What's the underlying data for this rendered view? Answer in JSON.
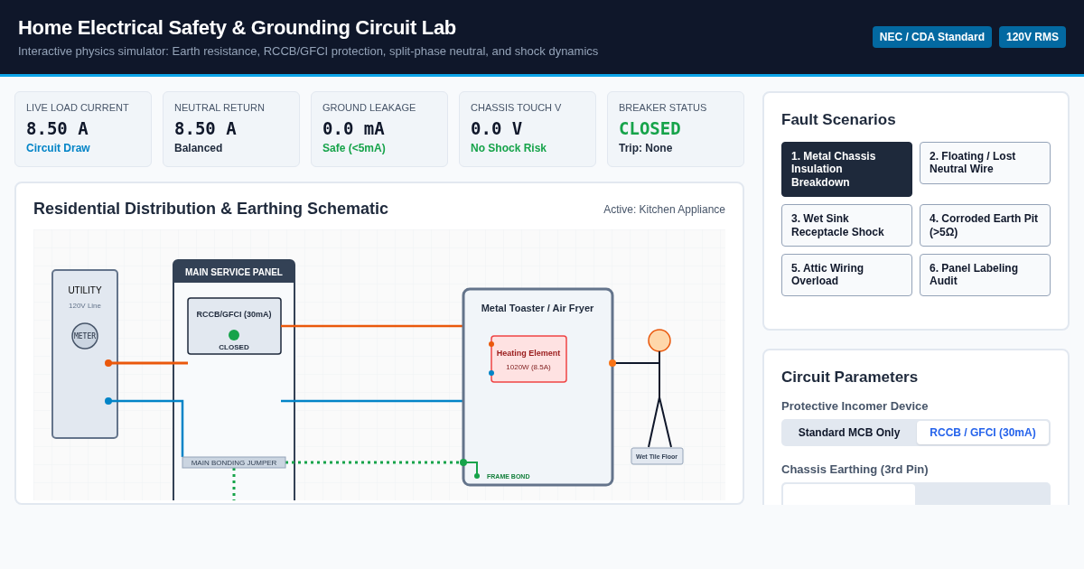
{
  "header": {
    "title": "Home Electrical Safety & Grounding Circuit Lab",
    "subtitle": "Interactive physics simulator: Earth resistance, RCCB/GFCI protection, split-phase neutral, and shock dynamics",
    "badges": [
      "NEC / CDA Standard",
      "120V RMS"
    ]
  },
  "stats": [
    {
      "label": "LIVE LOAD CURRENT",
      "kind": "reading",
      "value": "8.50 A",
      "note": "Circuit Draw",
      "color": "#0284c7"
    },
    {
      "label": "NEUTRAL RETURN",
      "kind": "reading",
      "value": "8.50 A",
      "note": "Balanced",
      "color": "#1e293b"
    },
    {
      "label": "GROUND LEAKAGE",
      "kind": "reading",
      "value": "0.0 mA",
      "note": "Safe (<5mA)",
      "color": "#16a34a"
    },
    {
      "label": "CHASSIS TOUCH V",
      "kind": "reading",
      "value": "0.0 V",
      "note": "No Shock Risk",
      "color": "#16a34a"
    },
    {
      "label": "BREAKER STATUS",
      "kind": "status",
      "value": "CLOSED",
      "note": "Trip: None",
      "color": "#1e293b"
    }
  ],
  "schematic": {
    "title": "Residential Distribution & Earthing Schematic",
    "active": "Active: Kitchen Appliance",
    "utility": {
      "title": "UTILITY",
      "subtitle": "120V Line",
      "meter": "METER"
    },
    "panel": {
      "title": "MAIN SERVICE PANEL",
      "breaker": "RCCB/GFCI (30mA)",
      "breaker_state": "CLOSED",
      "breaker_closed": true,
      "jumper": "MAIN BONDING JUMPER"
    },
    "appliance": {
      "title": "Metal Toaster / Air Fryer",
      "element": "Heating Element",
      "element_rating": "1020W (8.5A)",
      "frame_bond": "FRAME BOND"
    },
    "floor": "Wet Tile Floor"
  },
  "fault_scenarios": {
    "title": "Fault Scenarios",
    "items": [
      {
        "label": "1. Metal Chassis Insulation Breakdown",
        "selected": true
      },
      {
        "label": "2. Floating / Lost Neutral Wire",
        "selected": false
      },
      {
        "label": "3. Wet Sink Receptacle Shock",
        "selected": false
      },
      {
        "label": "4. Corroded Earth Pit (>5Ω)",
        "selected": false
      },
      {
        "label": "5. Attic Wiring Overload",
        "selected": false
      },
      {
        "label": "6. Panel Labeling Audit",
        "selected": false
      }
    ]
  },
  "parameters": {
    "title": "Circuit Parameters",
    "groups": [
      {
        "label": "Protective Incomer Device",
        "options": [
          {
            "label": "Standard MCB Only",
            "selected": false
          },
          {
            "label": "RCCB / GFCI (30mA)",
            "selected": true
          }
        ]
      },
      {
        "label": "Chassis Earthing (3rd Pin)"
      }
    ]
  }
}
